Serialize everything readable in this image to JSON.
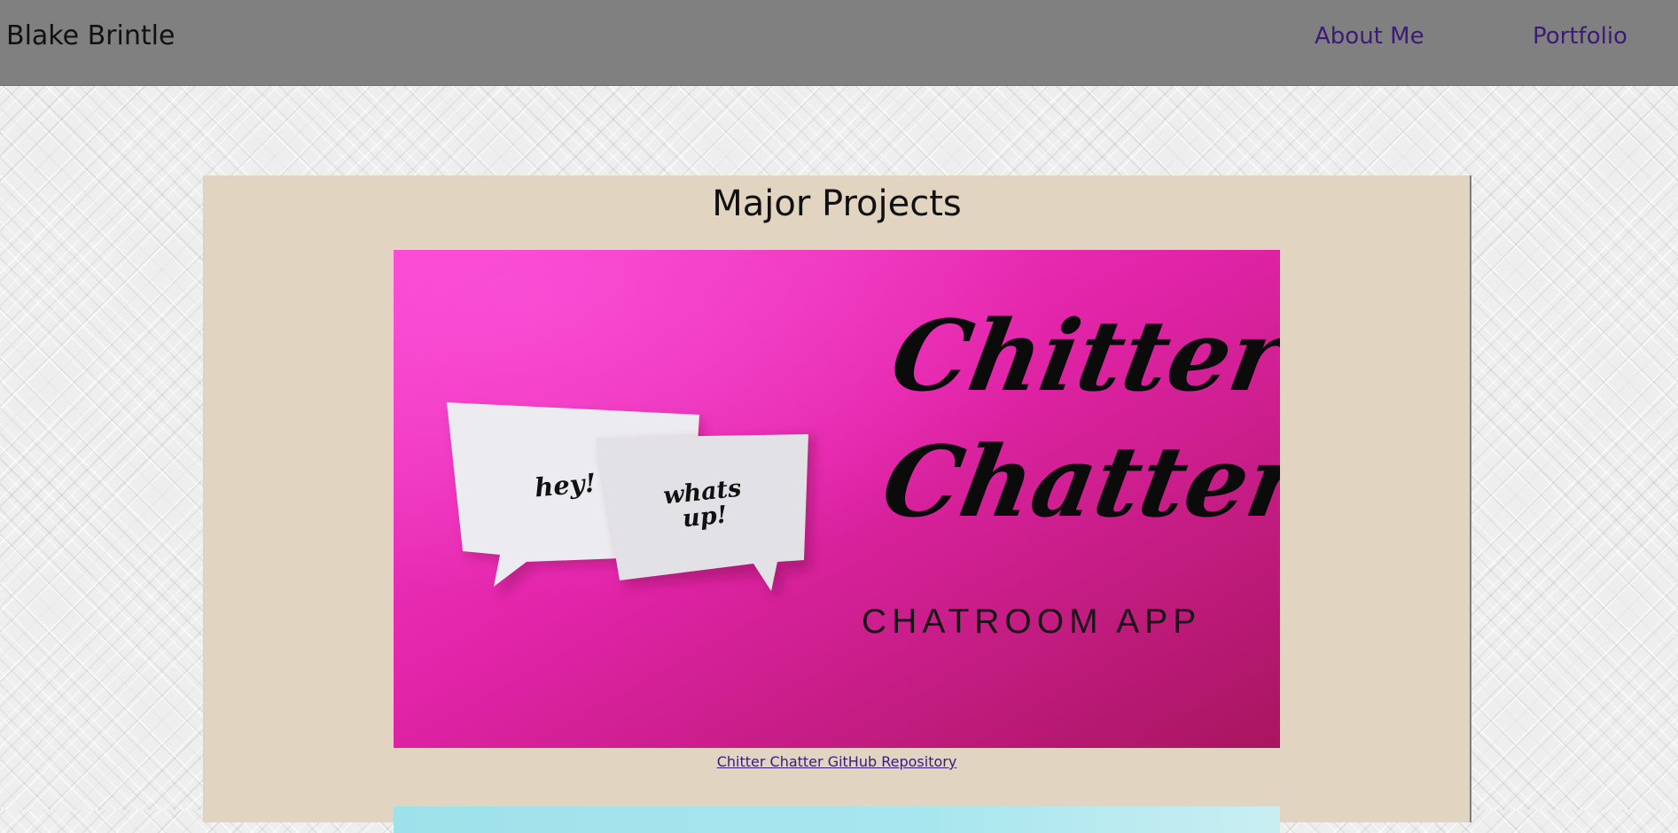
{
  "header": {
    "brand": "Blake Brintle",
    "nav": [
      {
        "label": "About Me"
      },
      {
        "label": "Portfolio"
      }
    ]
  },
  "main": {
    "title": "Major Projects",
    "projects": [
      {
        "image_text": {
          "bubble1": "hey!",
          "bubble2_line1": "whats",
          "bubble2_line2": "up!",
          "title_line1": "Chitter",
          "title_line2": "Chatter",
          "subtitle": "CHATROOM APP"
        },
        "link_label": "Chitter Chatter GitHub Repository"
      }
    ]
  },
  "colors": {
    "navbar": "#808080",
    "nav_link": "#3c1a78",
    "panel": "#e1d4c1",
    "image_magenta": "#e626b0"
  }
}
